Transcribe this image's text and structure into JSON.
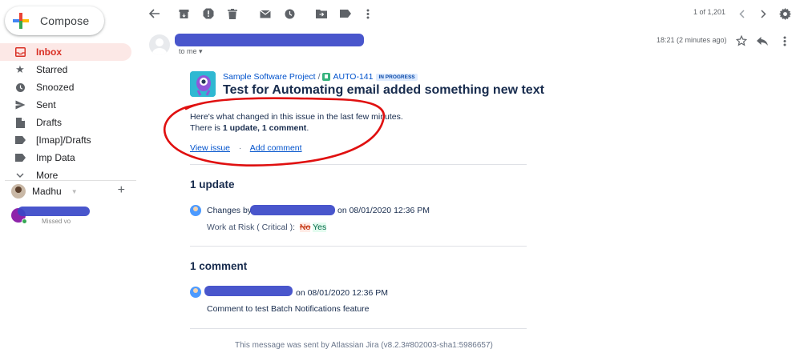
{
  "sidebar": {
    "compose_label": "Compose",
    "items": [
      {
        "label": "Inbox",
        "icon": "inbox-icon",
        "active": true
      },
      {
        "label": "Starred",
        "icon": "star-icon"
      },
      {
        "label": "Snoozed",
        "icon": "clock-icon"
      },
      {
        "label": "Sent",
        "icon": "send-icon"
      },
      {
        "label": "Drafts",
        "icon": "draft-icon"
      },
      {
        "label": "[Imap]/Drafts",
        "icon": "label-icon"
      },
      {
        "label": "Imp Data",
        "icon": "label-icon"
      },
      {
        "label": "More",
        "icon": "chevron-down-icon"
      }
    ],
    "hangouts_user": "Madhu",
    "contact_status": "Missed vo"
  },
  "toolbar": {
    "pager": "1 of 1,201"
  },
  "message": {
    "recipient": "to me",
    "time": "18:21 (2 minutes ago)"
  },
  "email": {
    "project": "Sample Software Project",
    "separator": "/",
    "issue_key": "AUTO-141",
    "status": "IN PROGRESS",
    "title": "Test for Automating email added something new text",
    "change_line1": "Here's what changed in this issue in the last few minutes.",
    "change_prefix": "There is ",
    "change_bold": "1 update, 1 comment",
    "change_suffix": ".",
    "view_issue": "View issue",
    "dot": "·",
    "add_comment": "Add comment",
    "updates_title": "1 update",
    "changes_by": "Changes by",
    "update_date": "on 08/01/2020 12:36 PM",
    "field_name": "Work at Risk ( Critical ):",
    "old_value": "No",
    "new_value": "Yes",
    "comments_title": "1 comment",
    "comment_date": "on 08/01/2020 12:36 PM",
    "comment_text": "Comment to test Batch Notifications feature",
    "footer": "This message was sent by Atlassian Jira (v8.2.3#802003-sha1:5986657)"
  },
  "colors": {
    "accent_red": "#d93025",
    "jira_blue": "#0052cc",
    "highlight_red": "#e01010",
    "redaction_blue": "#3a48c8"
  }
}
